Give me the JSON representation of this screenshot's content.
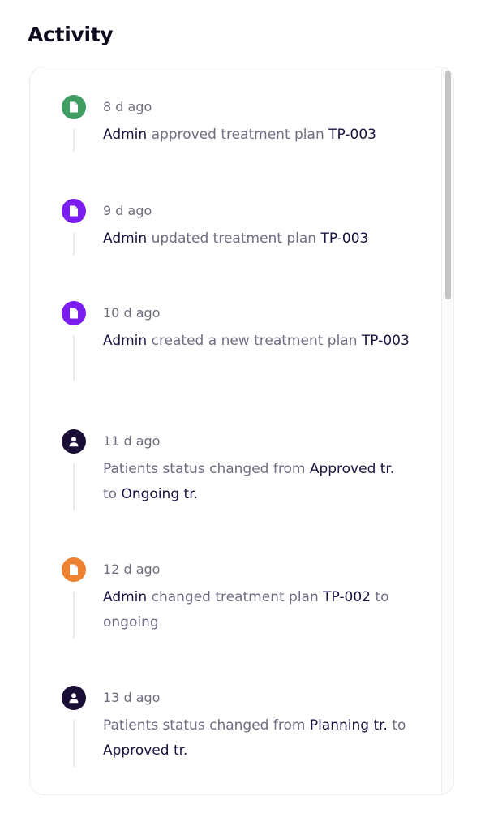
{
  "header": {
    "title": "Activity"
  },
  "colors": {
    "green": "#3f9c63",
    "purple": "#7b1cf0",
    "dark": "#1a0d36",
    "orange": "#ee8231"
  },
  "items": [
    {
      "time": "8 d ago",
      "icon": "document-icon",
      "color": "green",
      "parts": [
        {
          "text": "Admin",
          "strong": true
        },
        {
          "text": " approved treatment plan ",
          "strong": false
        },
        {
          "text": "TP-003",
          "strong": true
        }
      ]
    },
    {
      "time": "9 d ago",
      "icon": "document-icon",
      "color": "purple",
      "parts": [
        {
          "text": "Admin",
          "strong": true
        },
        {
          "text": " updated treatment plan ",
          "strong": false
        },
        {
          "text": "TP-003",
          "strong": true
        }
      ]
    },
    {
      "time": "10 d ago",
      "icon": "document-icon",
      "color": "purple",
      "parts": [
        {
          "text": "Admin",
          "strong": true
        },
        {
          "text": " created a new treatment plan ",
          "strong": false
        },
        {
          "text": "TP-003",
          "strong": true
        }
      ]
    },
    {
      "time": "11 d ago",
      "icon": "user-icon",
      "color": "dark",
      "parts": [
        {
          "text": "Patients status changed from ",
          "strong": false
        },
        {
          "text": "Approved tr.",
          "strong": true
        },
        {
          "text": " to ",
          "strong": false
        },
        {
          "text": "Ongoing tr.",
          "strong": true
        }
      ]
    },
    {
      "time": "12 d ago",
      "icon": "document-icon",
      "color": "orange",
      "parts": [
        {
          "text": "Admin",
          "strong": true
        },
        {
          "text": " changed treatment plan ",
          "strong": false
        },
        {
          "text": "TP-002",
          "strong": true
        },
        {
          "text": " to ongoing",
          "strong": false
        }
      ]
    },
    {
      "time": "13 d ago",
      "icon": "user-icon",
      "color": "dark",
      "parts": [
        {
          "text": "Patients status changed from ",
          "strong": false
        },
        {
          "text": "Planning tr.",
          "strong": true
        },
        {
          "text": " to ",
          "strong": false
        },
        {
          "text": "Approved tr.",
          "strong": true
        }
      ]
    }
  ]
}
